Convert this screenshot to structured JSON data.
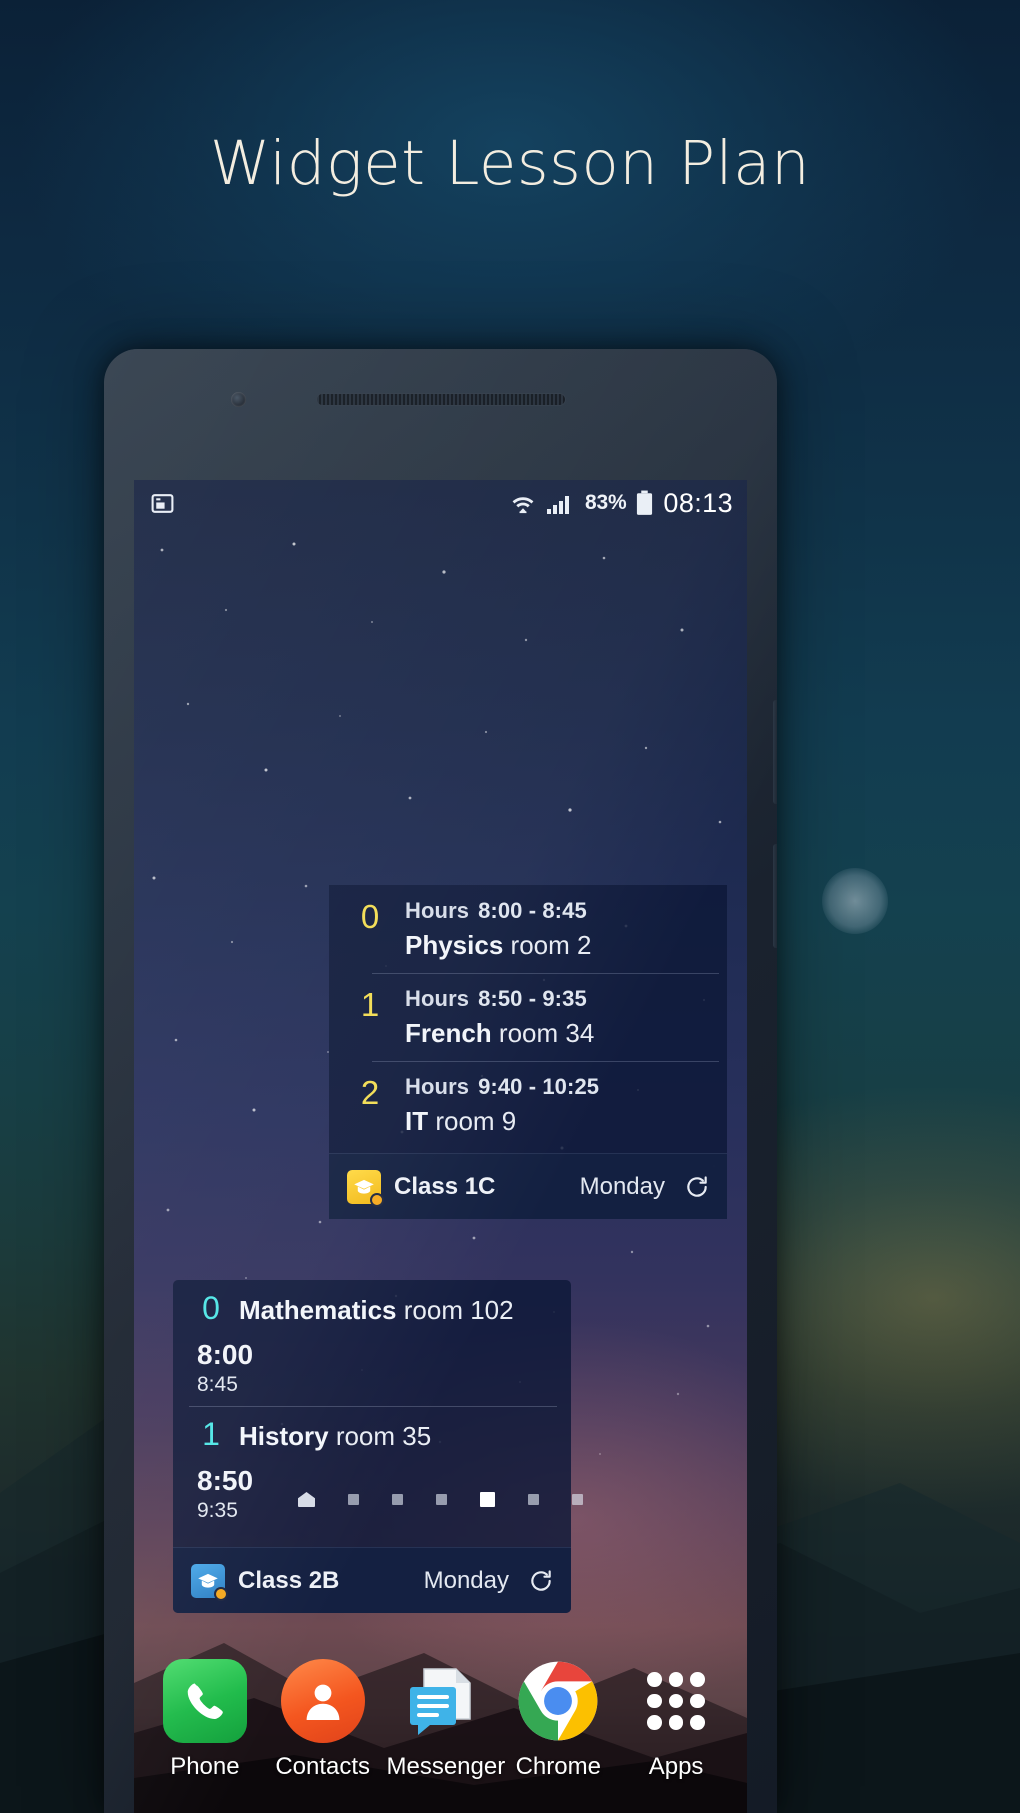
{
  "page": {
    "title": "Widget Lesson Plan"
  },
  "statusbar": {
    "left_icon": "screenshot-icon",
    "wifi_icon": "wifi-icon",
    "signal_icon": "signal-icon",
    "battery_percent": "83%",
    "battery_icon": "battery-icon",
    "time": "08:13"
  },
  "widget1": {
    "name": "Class 1C lesson plan widget",
    "accent_color": "#f2dc52",
    "hours_label": "Hours",
    "rows": [
      {
        "num": "0",
        "hours": "8:00 - 8:45",
        "subject": "Physics",
        "room": "room 2"
      },
      {
        "num": "1",
        "hours": "8:50 - 9:35",
        "subject": "French",
        "room": "room 34"
      },
      {
        "num": "2",
        "hours": "9:40 - 10:25",
        "subject": "IT",
        "room": "room 9"
      }
    ],
    "footer": {
      "icon": "graduation-cap-icon",
      "class_name": "Class 1C",
      "day": "Monday",
      "refresh_icon": "refresh-icon"
    }
  },
  "widget2": {
    "name": "Class 2B lesson plan widget",
    "accent_color": "#4fe6e6",
    "rows": [
      {
        "num": "0",
        "subject": "Mathematics",
        "room": "room 102",
        "start": "8:00",
        "end": "8:45"
      },
      {
        "num": "1",
        "subject": "History",
        "room": "room 35",
        "start": "8:50",
        "end": "9:35"
      }
    ],
    "footer": {
      "icon": "graduation-cap-icon",
      "class_name": "Class 2B",
      "day": "Monday",
      "refresh_icon": "refresh-icon"
    }
  },
  "page_indicator": {
    "count": 7,
    "active_index": 4,
    "home_index": 0
  },
  "dock": {
    "items": [
      {
        "label": "Phone",
        "icon": "phone-icon"
      },
      {
        "label": "Contacts",
        "icon": "contacts-icon"
      },
      {
        "label": "Messenger",
        "icon": "messenger-icon"
      },
      {
        "label": "Chrome",
        "icon": "chrome-icon"
      },
      {
        "label": "Apps",
        "icon": "apps-grid-icon"
      }
    ]
  }
}
